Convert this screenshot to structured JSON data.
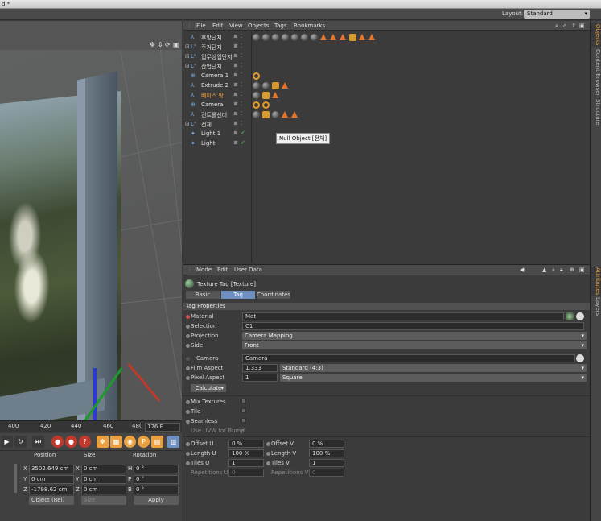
{
  "window": {
    "title_fragment": "d *"
  },
  "layout": {
    "label": "Layout:",
    "value": "Standard"
  },
  "viewport": {
    "timeline_ticks": [
      "400",
      "420",
      "440",
      "460",
      "48("
    ],
    "current_frame": "126 F"
  },
  "coords": {
    "headers": {
      "position": "Position",
      "size": "Size",
      "rotation": "Rotation"
    },
    "rows": [
      {
        "axis": "X",
        "pos": "3502.649 cm",
        "size_axis": "X",
        "size": "0 cm",
        "rot_axis": "H",
        "rot": "0 °"
      },
      {
        "axis": "Y",
        "pos": "0 cm",
        "size_axis": "Y",
        "size": "0 cm",
        "rot_axis": "P",
        "rot": "0 °"
      },
      {
        "axis": "Z",
        "pos": "-1798.62 cm",
        "size_axis": "Z",
        "size": "0 cm",
        "rot_axis": "B",
        "rot": "0 °"
      }
    ],
    "mode_select": "Object (Rel)",
    "size_select": "Size",
    "apply_label": "Apply"
  },
  "object_manager": {
    "menu": [
      "File",
      "Edit",
      "View",
      "Objects",
      "Tags",
      "Bookmarks"
    ],
    "objects": [
      {
        "name": "후망단지",
        "icon": "extrude-icon",
        "tags": "dddddddtttxtt"
      },
      {
        "name": "주거단지",
        "icon": "null-icon",
        "tags": ""
      },
      {
        "name": "업무상업단지",
        "icon": "null-icon",
        "tags": ""
      },
      {
        "name": "산업단지",
        "icon": "null-icon",
        "tags": ""
      },
      {
        "name": "Camera.1",
        "icon": "camera-icon",
        "tags": "o"
      },
      {
        "name": "Extrude.2",
        "icon": "extrude-icon",
        "tags": "ddxt"
      },
      {
        "name": "베이스 땅",
        "icon": "extrude-icon",
        "tags": "dxt"
      },
      {
        "name": "Camera",
        "icon": "camera-icon",
        "tags": "oo"
      },
      {
        "name": "컨트롤센터",
        "icon": "extrude-icon",
        "tags": "dxdtt"
      },
      {
        "name": "전체",
        "icon": "null-icon",
        "tags": ""
      },
      {
        "name": "Light.1",
        "icon": "light-icon",
        "tags": ""
      },
      {
        "name": "Light",
        "icon": "light-icon",
        "tags": ""
      }
    ],
    "tooltip": "Null Object [전체]"
  },
  "attributes": {
    "menu": [
      "Mode",
      "Edit",
      "User Data"
    ],
    "title": "Texture Tag [Texture]",
    "tabs": [
      "Basic",
      "Tag",
      "Coordinates"
    ],
    "active_tab": "Tag",
    "section": "Tag Properties",
    "material_label": "Material",
    "material_value": "Mat",
    "selection_label": "Selection",
    "selection_value": "C1",
    "projection_label": "Projection",
    "projection_value": "Camera Mapping",
    "side_label": "Side",
    "side_value": "Front",
    "camera_label": "Camera",
    "camera_value": "Camera",
    "film_label": "Film Aspect",
    "film_value": "1.333",
    "film_preset": "Standard (4:3)",
    "pixel_label": "Pixel Aspect",
    "pixel_value": "1",
    "pixel_preset": "Square",
    "calculate_label": "Calculate",
    "mix_label": "Mix Textures",
    "tile_label": "Tile",
    "seamless_label": "Seamless",
    "uvw_label": "Use UVW for Bump",
    "offset_u_label": "Offset U",
    "offset_u": "0 %",
    "offset_v_label": "Offset V",
    "offset_v": "0 %",
    "length_u_label": "Length U",
    "length_u": "100 %",
    "length_v_label": "Length V",
    "length_v": "100 %",
    "tiles_u_label": "Tiles U",
    "tiles_u": "1",
    "tiles_v_label": "Tiles V",
    "tiles_v": "1",
    "rep_u_label": "Repetitions U",
    "rep_u": "0",
    "rep_v_label": "Repetitions V",
    "rep_v": "0"
  },
  "side_tabs": {
    "top": [
      "Objects",
      "Content Browser",
      "Structure"
    ],
    "bottom": [
      "Attributes",
      "Layers"
    ]
  },
  "colors": {
    "selected_object": "#f0a030",
    "active_tab": "#6e90c0",
    "tag_orange": "#e8732a"
  }
}
